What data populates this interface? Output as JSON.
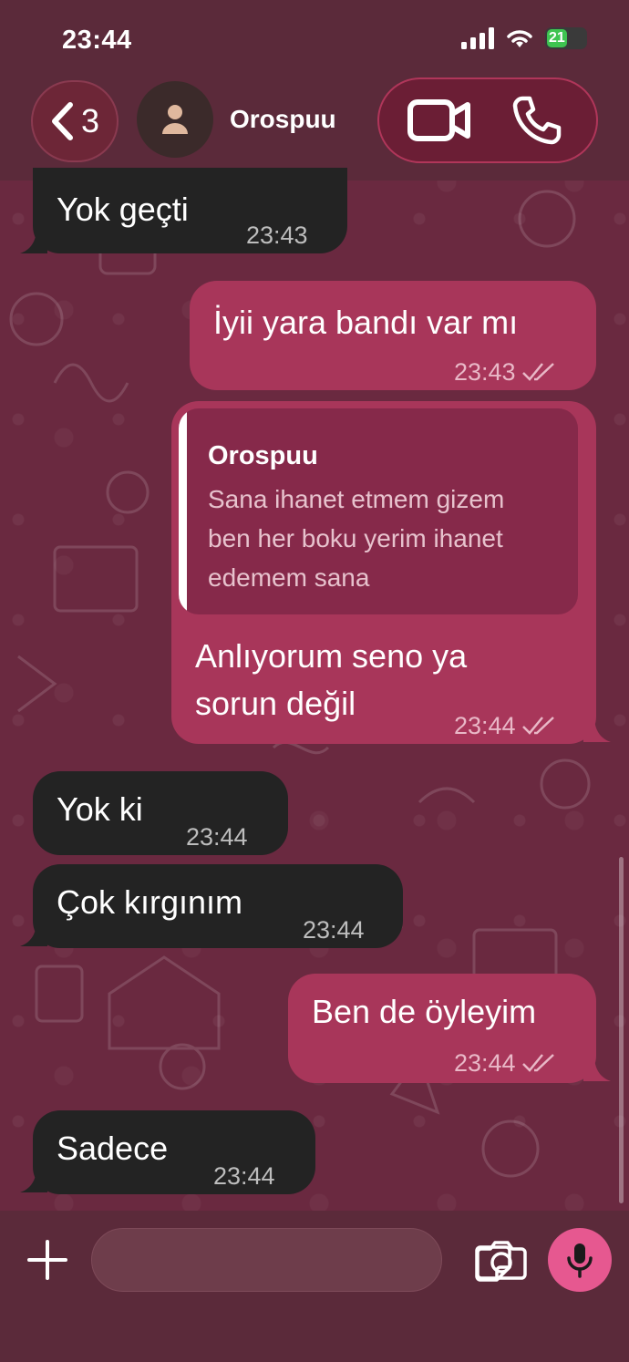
{
  "status_bar": {
    "time": "23:44",
    "battery": "21"
  },
  "header": {
    "back_count": "3",
    "contact_name": "Orospuu",
    "icons": [
      "chevron-left-icon",
      "person-icon",
      "video-camera-icon",
      "phone-icon"
    ]
  },
  "messages": [
    {
      "direction": "incoming",
      "text": "Yok geçti",
      "time": "23:43"
    },
    {
      "direction": "outgoing",
      "text": "İyii yara bandı  var mı",
      "time": "23:43",
      "read": true
    },
    {
      "direction": "outgoing",
      "reply_to": {
        "name": "Orospuu",
        "text_lines": [
          "Sana ihanet etmem gizem",
          "ben her boku yerim ihanet",
          "edemem sana"
        ]
      },
      "text_lines": [
        "Anlıyorum seno ya",
        "sorun değil"
      ],
      "time": "23:44",
      "read": true
    },
    {
      "direction": "incoming",
      "text": "Yok ki",
      "time": "23:44"
    },
    {
      "direction": "incoming",
      "text": "Çok kırgınım",
      "time": "23:44"
    },
    {
      "direction": "outgoing",
      "text": "Ben de öyleyim",
      "time": "23:44",
      "read": true
    },
    {
      "direction": "incoming",
      "text": "Sadece",
      "time": "23:44"
    }
  ],
  "input_bar": {
    "message_value": "",
    "icons": [
      "plus-icon",
      "sticker-icon",
      "camera-icon",
      "microphone-icon"
    ]
  },
  "colors": {
    "header_bg": "#5b2a3a",
    "wallpaper": "#6a2940",
    "incoming_bubble": "#232323",
    "outgoing_bubble": "#a8365a",
    "mic_button": "#e65890"
  }
}
